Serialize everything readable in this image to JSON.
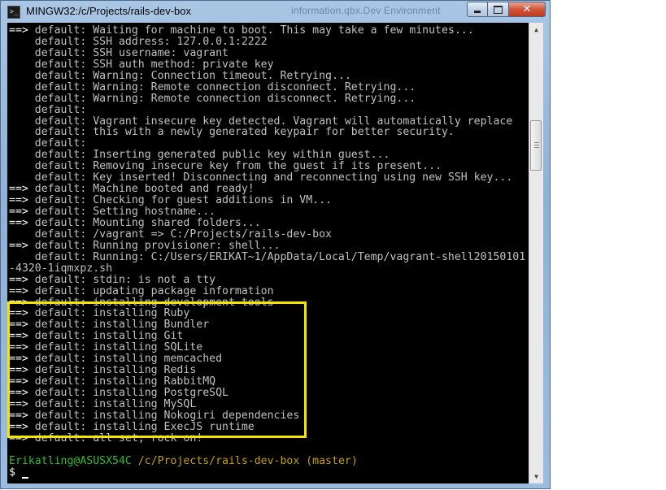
{
  "window": {
    "title": "MINGW32:/c/Projects/rails-dev-box",
    "title_overlay": "information.qbx.Dev Environment"
  },
  "controls": {
    "minimize_icon": "minimize-icon",
    "maximize_icon": "maximize-icon",
    "close_icon": "close-icon"
  },
  "colors": {
    "terminal_bg": "#000000",
    "terminal_text": "#c0c0c0",
    "prompt_user": "#2fbf2f",
    "prompt_path": "#c8a000",
    "highlight_box": "#f5e400"
  },
  "terminal": {
    "lines": [
      {
        "arrow": "==> ",
        "text": "default: Waiting for machine to boot. This may take a few minutes..."
      },
      {
        "arrow": "    ",
        "text": "default: SSH address: 127.0.0.1:2222"
      },
      {
        "arrow": "    ",
        "text": "default: SSH username: vagrant"
      },
      {
        "arrow": "    ",
        "text": "default: SSH auth method: private key"
      },
      {
        "arrow": "    ",
        "text": "default: Warning: Connection timeout. Retrying..."
      },
      {
        "arrow": "    ",
        "text": "default: Warning: Remote connection disconnect. Retrying..."
      },
      {
        "arrow": "    ",
        "text": "default: Warning: Remote connection disconnect. Retrying..."
      },
      {
        "arrow": "    ",
        "text": "default:"
      },
      {
        "arrow": "    ",
        "text": "default: Vagrant insecure key detected. Vagrant will automatically replace"
      },
      {
        "arrow": "    ",
        "text": "default: this with a newly generated keypair for better security."
      },
      {
        "arrow": "    ",
        "text": "default:"
      },
      {
        "arrow": "    ",
        "text": "default: Inserting generated public key within guest..."
      },
      {
        "arrow": "    ",
        "text": "default: Removing insecure key from the guest if its present..."
      },
      {
        "arrow": "    ",
        "text": "default: Key inserted! Disconnecting and reconnecting using new SSH key..."
      },
      {
        "arrow": "==> ",
        "text": "default: Machine booted and ready!"
      },
      {
        "arrow": "==> ",
        "text": "default: Checking for guest additions in VM..."
      },
      {
        "arrow": "==> ",
        "text": "default: Setting hostname..."
      },
      {
        "arrow": "==> ",
        "text": "default: Mounting shared folders..."
      },
      {
        "arrow": "    ",
        "text": "default: /vagrant => C:/Projects/rails-dev-box"
      },
      {
        "arrow": "==> ",
        "text": "default: Running provisioner: shell..."
      },
      {
        "arrow": "    ",
        "text": "default: Running: C:/Users/ERIKAT~1/AppData/Local/Temp/vagrant-shell20150101"
      },
      {
        "arrow": "",
        "text": "-4320-1iqmxpz.sh"
      },
      {
        "arrow": "==> ",
        "text": "default: stdin: is not a tty"
      },
      {
        "arrow": "==> ",
        "text": "default: updating package information"
      },
      {
        "arrow": "==> ",
        "text": "default: installing development tools"
      },
      {
        "arrow": "==> ",
        "text": "default: installing Ruby"
      },
      {
        "arrow": "==> ",
        "text": "default: installing Bundler"
      },
      {
        "arrow": "==> ",
        "text": "default: installing Git"
      },
      {
        "arrow": "==> ",
        "text": "default: installing SQLite"
      },
      {
        "arrow": "==> ",
        "text": "default: installing memcached"
      },
      {
        "arrow": "==> ",
        "text": "default: installing Redis"
      },
      {
        "arrow": "==> ",
        "text": "default: installing RabbitMQ"
      },
      {
        "arrow": "==> ",
        "text": "default: installing PostgreSQL"
      },
      {
        "arrow": "==> ",
        "text": "default: installing MySQL"
      },
      {
        "arrow": "==> ",
        "text": "default: installing Nokogiri dependencies"
      },
      {
        "arrow": "==> ",
        "text": "default: installing ExecJS runtime"
      },
      {
        "arrow": "==> ",
        "text": "default: all set, rock on!"
      },
      {
        "arrow": "",
        "text": ""
      }
    ],
    "prompt": {
      "user_host": "Erikatling@ASUSX54C",
      "path": "/c/Projects/rails-dev-box (master)",
      "symbol": "$ "
    }
  }
}
